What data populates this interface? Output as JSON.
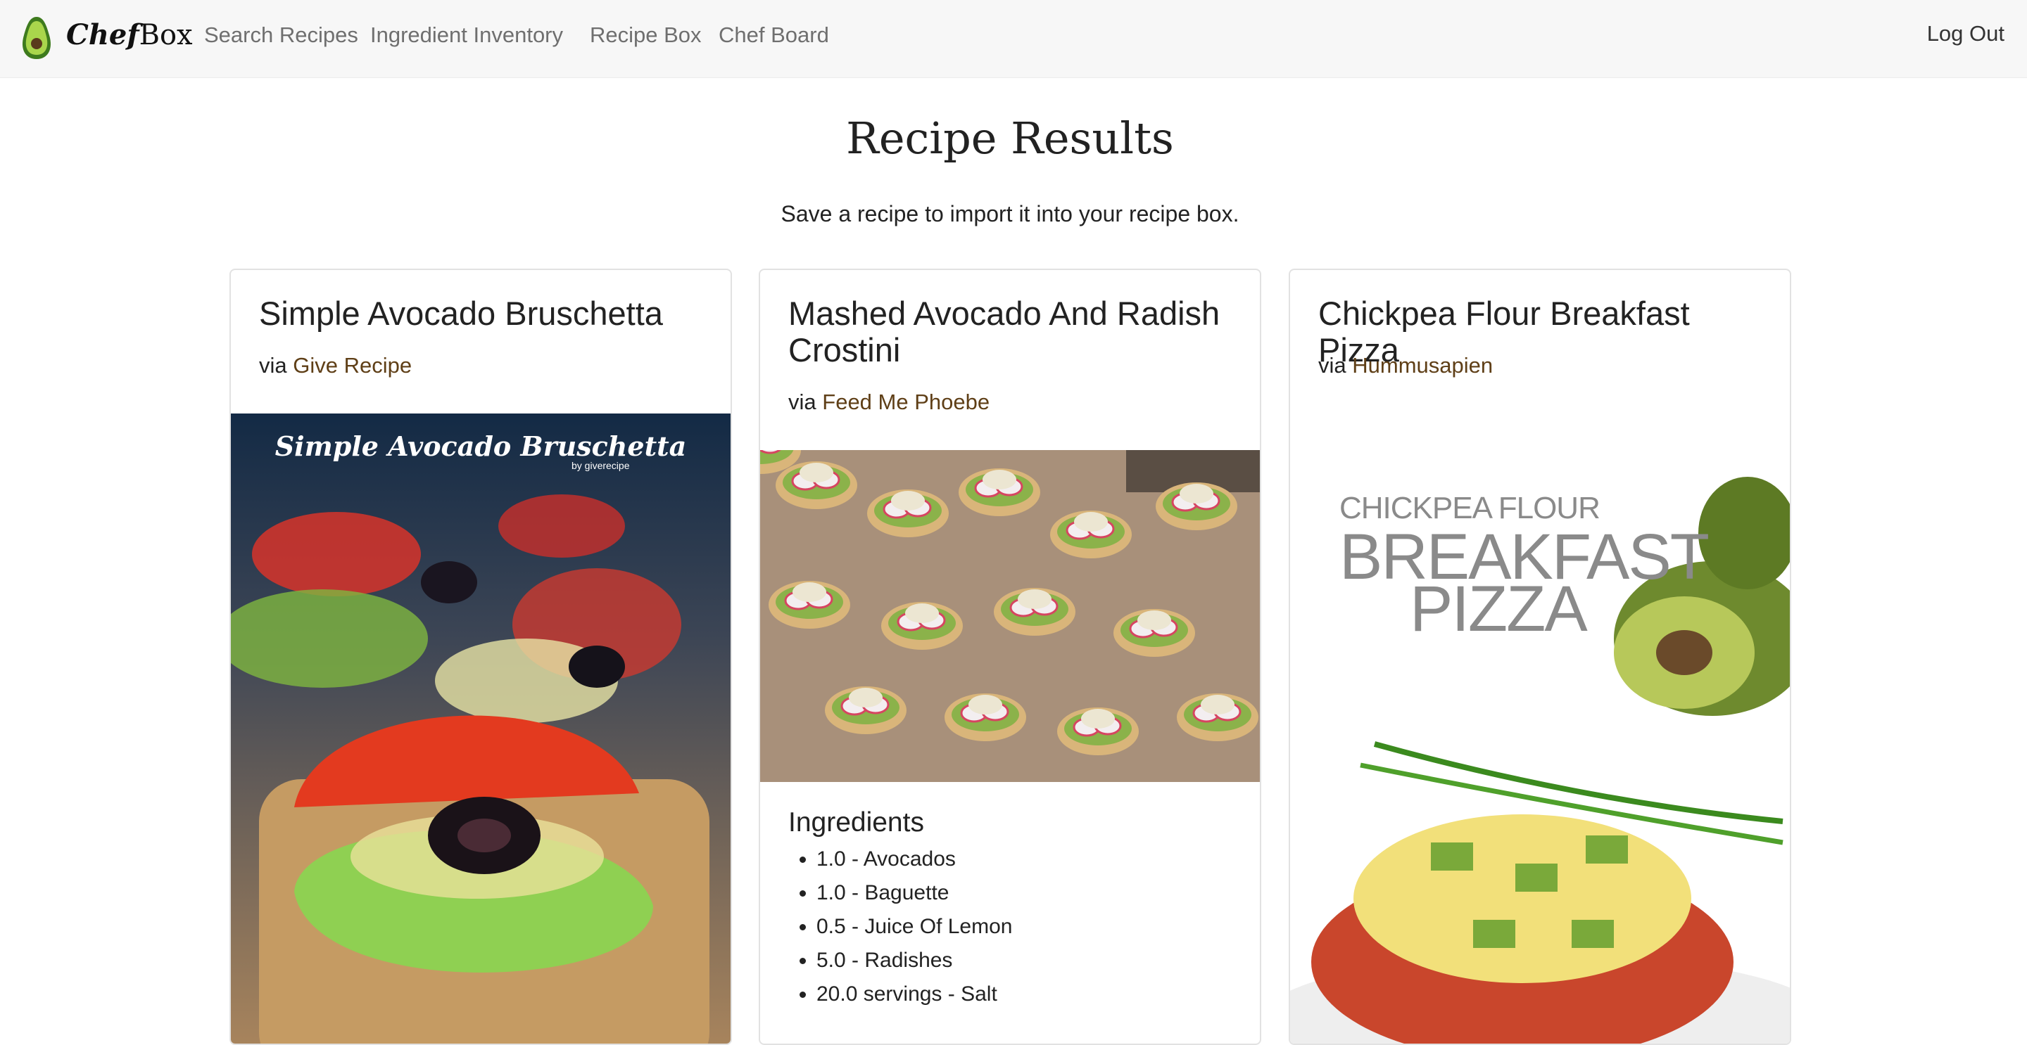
{
  "brand": {
    "part1": "Chef",
    "part2": "Box"
  },
  "nav": {
    "links": [
      "Search Recipes",
      "Ingredient Inventory",
      "Recipe Box",
      "Chef Board"
    ],
    "logout": "Log Out"
  },
  "page": {
    "title": "Recipe Results",
    "subtitle": "Save a recipe to import it into your recipe box."
  },
  "recipes": [
    {
      "title": "Simple Avocado Bruschetta",
      "via": "via",
      "source": "Give Recipe",
      "image_caption": "Simple Avocado Bruschetta",
      "image_caption_small": "by giverecipe"
    },
    {
      "title": "Mashed Avocado And Radish Crostini",
      "via": "via",
      "source": "Feed Me Phoebe",
      "ingredients_heading": "Ingredients",
      "ingredients": [
        "1.0 - Avocados",
        "1.0 - Baguette",
        "0.5 - Juice Of Lemon",
        "5.0 - Radishes",
        "20.0 servings - Salt"
      ]
    },
    {
      "title": "Chickpea Flour Breakfast Pizza",
      "via": "via",
      "source": "Hummusapien",
      "image_lines": [
        "CHICKPEA FLOUR",
        "BREAKFAST",
        "PIZZA"
      ]
    }
  ],
  "colors": {
    "link": "#5f3f17",
    "nav_bg": "#f7f7f7",
    "avocado": "#8cc63f"
  },
  "icons": [
    "avocado-logo-icon"
  ]
}
